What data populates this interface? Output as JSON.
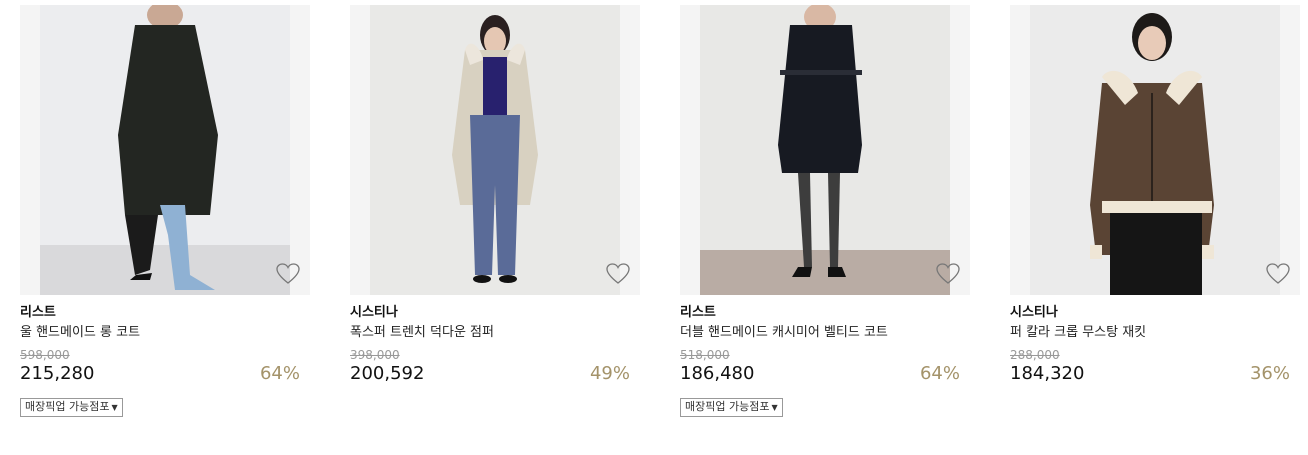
{
  "products": [
    {
      "brand": "리스트",
      "name": "울 핸드메이드 롱 코트",
      "original_price": "598,000",
      "price": "215,280",
      "discount": "64%",
      "pickup_label": "매장픽업 가능점포",
      "pickup_arrow": "▼",
      "has_pickup": true
    },
    {
      "brand": "시스티나",
      "name": "폭스퍼 트렌치 덕다운 점퍼",
      "original_price": "398,000",
      "price": "200,592",
      "discount": "49%",
      "has_pickup": false
    },
    {
      "brand": "리스트",
      "name": "더블 핸드메이드 캐시미어 벨티드 코트",
      "original_price": "518,000",
      "price": "186,480",
      "discount": "64%",
      "pickup_label": "매장픽업 가능점포",
      "pickup_arrow": "▼",
      "has_pickup": true
    },
    {
      "brand": "시스티나",
      "name": "퍼 칼라 크롭 무스탕 재킷",
      "original_price": "288,000",
      "price": "184,320",
      "discount": "36%",
      "has_pickup": false
    }
  ],
  "icons": {
    "wishlist": "heart-outline-icon"
  },
  "colors": {
    "discount": "#a4936a",
    "original_price": "#999999"
  }
}
